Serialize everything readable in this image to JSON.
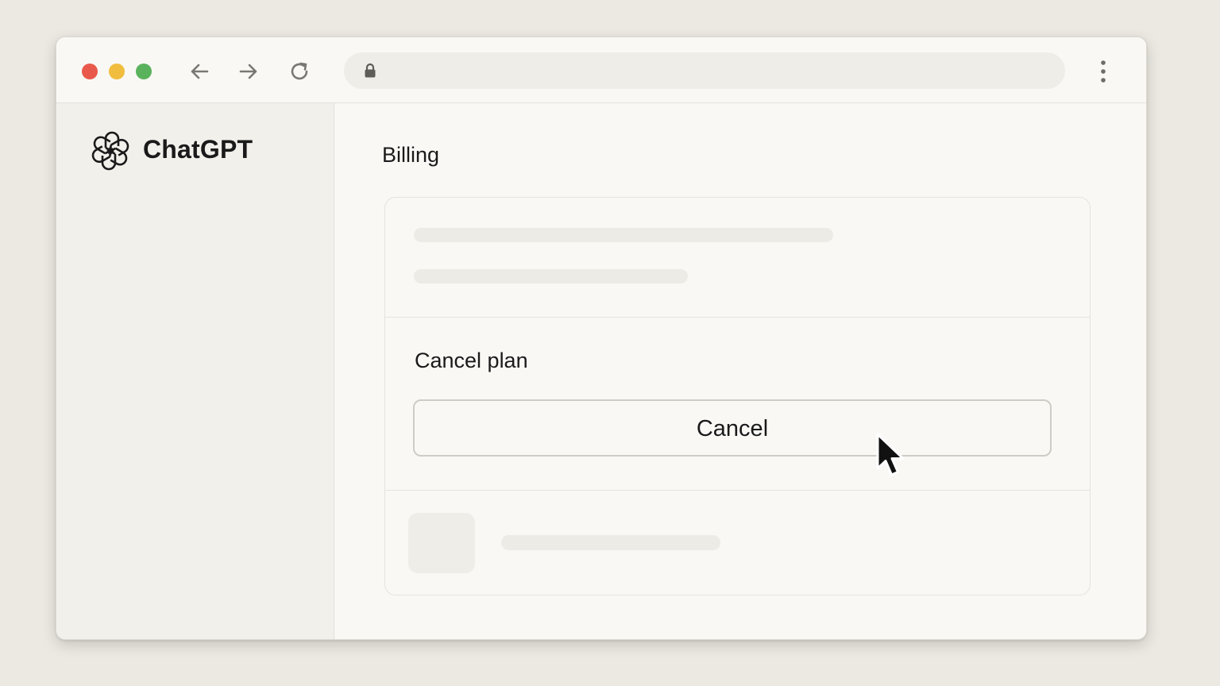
{
  "sidebar": {
    "brand": "ChatGPT",
    "logo_icon": "openai-logo-icon"
  },
  "main": {
    "page_title": "Billing",
    "cancel_section": {
      "title": "Cancel plan",
      "button_label": "Cancel"
    }
  },
  "browser": {
    "window_controls": [
      "close",
      "minimize",
      "maximize"
    ],
    "nav_icons": [
      "back-arrow-icon",
      "forward-arrow-icon",
      "reload-icon"
    ],
    "address_icon": "lock-icon",
    "menu_icon": "kebab-menu-icon"
  },
  "colors": {
    "background": "#ebe9e1",
    "window": "#f9f8f5",
    "sidebar": "#f2f0eb",
    "close": "#e9594b",
    "minimize": "#f1bd3e",
    "maximize": "#5bb25c",
    "text": "#1a1a1a"
  }
}
